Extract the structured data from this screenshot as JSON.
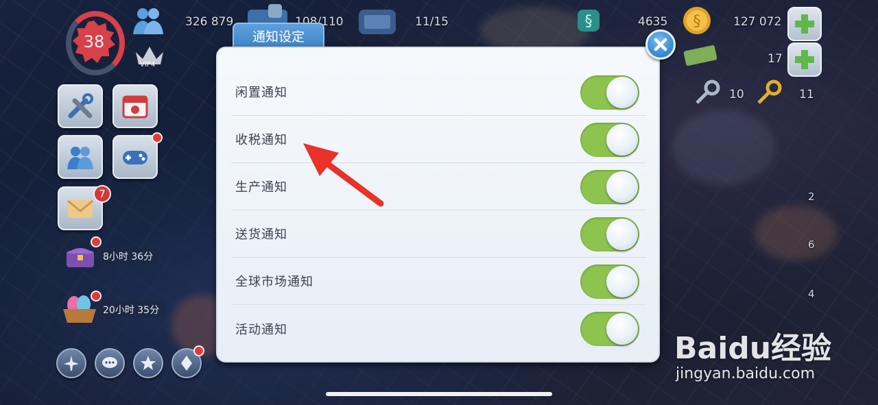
{
  "hud": {
    "level": "38",
    "population": "326 879",
    "storage": "108/110",
    "workers": "11/15",
    "simcash": "4635",
    "coins": "127 072",
    "right_counter_1": "17",
    "keys_left": "10",
    "keys_right": "11",
    "vip_label": "VIP4"
  },
  "left_panel": {
    "mail_badge": "7",
    "chest_timer": "8小时 36分",
    "basket_timer": "20小时 35分"
  },
  "map_counters": [
    "2",
    "6",
    "4"
  ],
  "dialog": {
    "tab_title": "通知设定",
    "rows": [
      {
        "label": "闲置通知",
        "enabled": true
      },
      {
        "label": "收税通知",
        "enabled": true
      },
      {
        "label": "生产通知",
        "enabled": true
      },
      {
        "label": "送货通知",
        "enabled": true
      },
      {
        "label": "全球市场通知",
        "enabled": true
      },
      {
        "label": "活动通知",
        "enabled": true
      }
    ]
  },
  "watermark": {
    "logo_text": "Baidu经验",
    "url": "jingyan.baidu.com"
  },
  "colors": {
    "toggle_on": "#8dc34f",
    "dialog_tab": "#4a8fd0",
    "annotation_arrow": "#e8322a",
    "level_badge": "#d8404a"
  }
}
